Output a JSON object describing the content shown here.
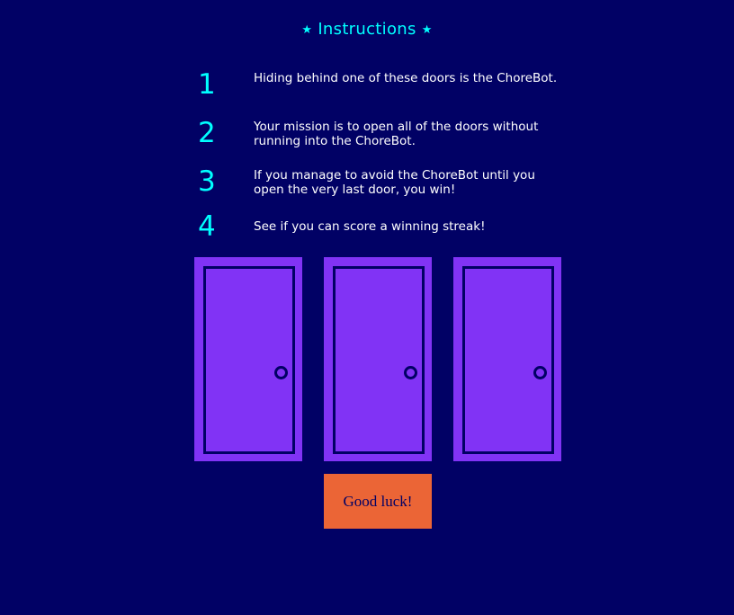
{
  "title": {
    "text": "Instructions",
    "star_left": "★",
    "star_right": "★"
  },
  "instructions": [
    {
      "number": "1",
      "text": "Hiding behind one of these doors is the ChoreBot."
    },
    {
      "number": "2",
      "text": "Your mission is to open all of the doors without running into the ChoreBot."
    },
    {
      "number": "3",
      "text": "If you manage to avoid the ChoreBot until you open the very last door, you win!"
    },
    {
      "number": "4",
      "text": "See if you can score a winning streak!"
    }
  ],
  "doors": [
    {
      "state": "closed"
    },
    {
      "state": "closed"
    },
    {
      "state": "closed"
    }
  ],
  "start_button": {
    "label": "Good luck!"
  },
  "colors": {
    "background": "#010165",
    "accent_cyan": "#00ffff",
    "door": "#8133f5",
    "button": "#eb6536",
    "text": "#ffffff"
  }
}
